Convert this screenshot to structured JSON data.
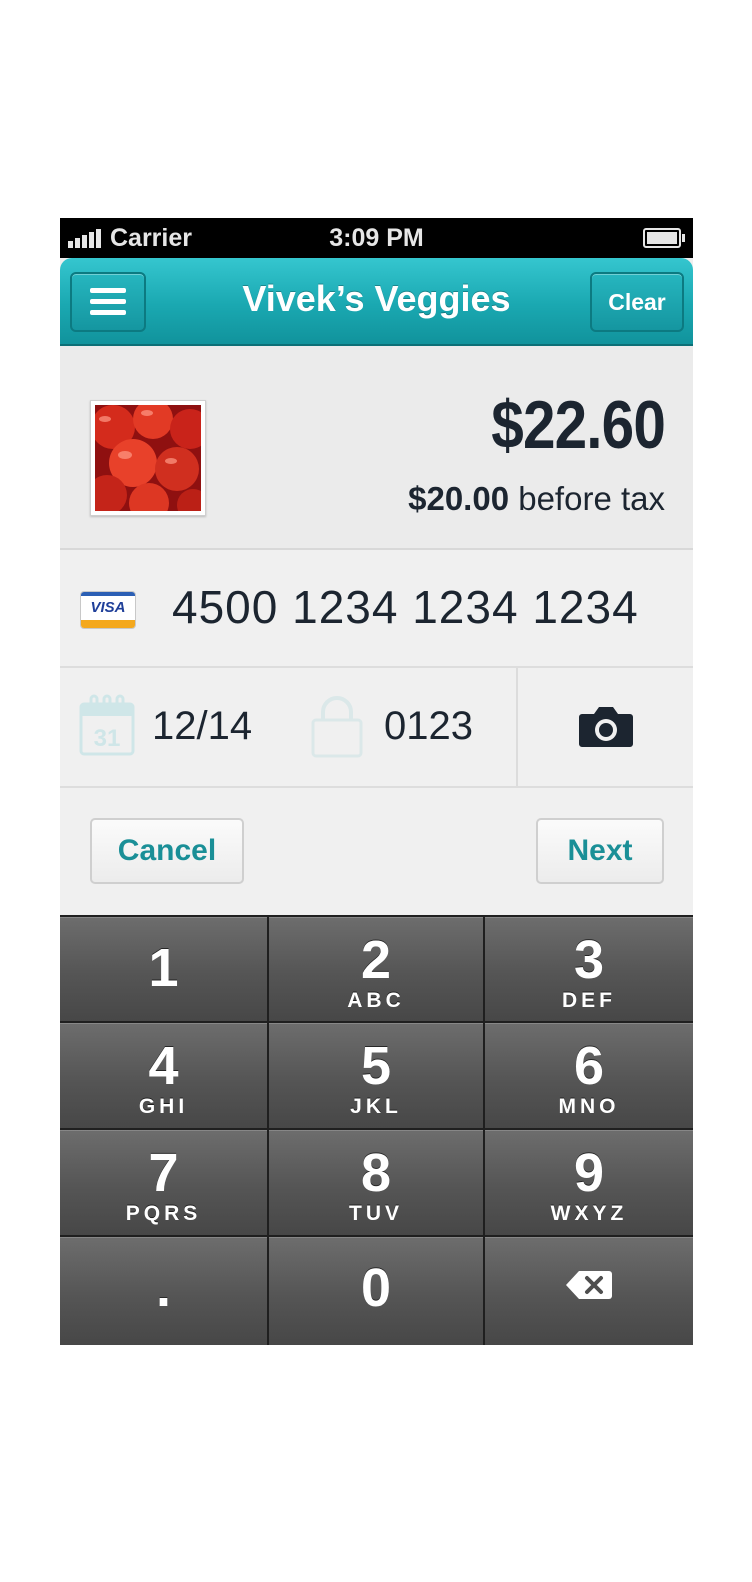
{
  "status_bar": {
    "carrier": "Carrier",
    "time": "3:09 PM"
  },
  "nav": {
    "title": "Vivek’s Veggies",
    "clear_label": "Clear",
    "menu_icon": "hamburger-menu-icon"
  },
  "order": {
    "total": "$22.60",
    "subtotal_amount": "$20.00",
    "subtotal_suffix": " before tax"
  },
  "card": {
    "brand": "VISA",
    "number": "4500 1234 1234 1234"
  },
  "details": {
    "expiry": "12/14",
    "calendar_day": "31",
    "cvv": "0123"
  },
  "actions": {
    "cancel_label": "Cancel",
    "next_label": "Next"
  },
  "keypad": {
    "keys": [
      {
        "num": "1",
        "letters": ""
      },
      {
        "num": "2",
        "letters": "ABC"
      },
      {
        "num": "3",
        "letters": "DEF"
      },
      {
        "num": "4",
        "letters": "GHI"
      },
      {
        "num": "5",
        "letters": "JKL"
      },
      {
        "num": "6",
        "letters": "MNO"
      },
      {
        "num": "7",
        "letters": "PQRS"
      },
      {
        "num": "8",
        "letters": "TUV"
      },
      {
        "num": "9",
        "letters": "WXYZ"
      },
      {
        "num": ".",
        "letters": ""
      },
      {
        "num": "0",
        "letters": ""
      },
      {
        "num": "",
        "letters": "",
        "icon": "backspace-icon"
      }
    ]
  },
  "colors": {
    "accent": "#1aa8b1",
    "text_dark": "#1c2530",
    "button_text": "#1a8f97"
  }
}
